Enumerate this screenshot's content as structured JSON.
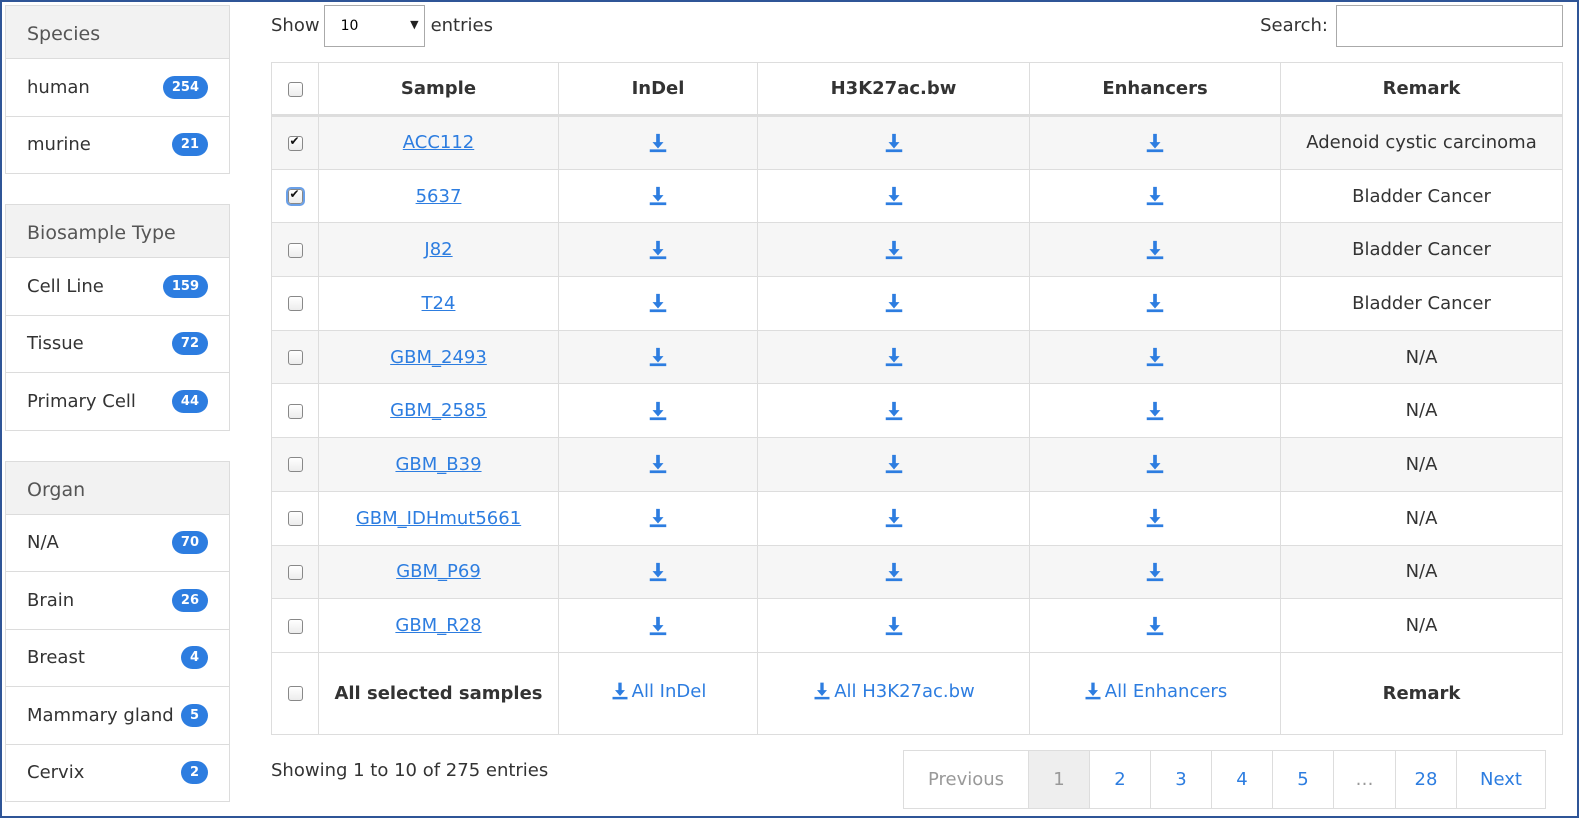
{
  "sidebar": {
    "species": {
      "title": "Species",
      "items": [
        {
          "label": "human",
          "count": "254"
        },
        {
          "label": "murine",
          "count": "21"
        }
      ]
    },
    "biosample": {
      "title": "Biosample Type",
      "items": [
        {
          "label": "Cell Line",
          "count": "159"
        },
        {
          "label": "Tissue",
          "count": "72"
        },
        {
          "label": "Primary Cell",
          "count": "44"
        }
      ]
    },
    "organ": {
      "title": "Organ",
      "items": [
        {
          "label": "N/A",
          "count": "70"
        },
        {
          "label": "Brain",
          "count": "26"
        },
        {
          "label": "Breast",
          "count": "4"
        },
        {
          "label": "Mammary gland",
          "count": "5"
        },
        {
          "label": "Cervix",
          "count": "2"
        }
      ]
    }
  },
  "controls": {
    "show_label": "Show",
    "entries_value": "10",
    "entries_label": "entries",
    "search_label": "Search:",
    "search_value": ""
  },
  "table": {
    "headers": {
      "sample": "Sample",
      "indel": "InDel",
      "h3k27ac": "H3K27ac.bw",
      "enhancers": "Enhancers",
      "remark": "Remark"
    },
    "rows": [
      {
        "sample": "ACC112",
        "remark": "Adenoid cystic carcinoma",
        "checked": true
      },
      {
        "sample": "5637",
        "remark": "Bladder Cancer",
        "checked": true
      },
      {
        "sample": "J82",
        "remark": "Bladder Cancer",
        "checked": false
      },
      {
        "sample": "T24",
        "remark": "Bladder Cancer",
        "checked": false
      },
      {
        "sample": "GBM_2493",
        "remark": "N/A",
        "checked": false
      },
      {
        "sample": "GBM_2585",
        "remark": "N/A",
        "checked": false
      },
      {
        "sample": "GBM_B39",
        "remark": "N/A",
        "checked": false
      },
      {
        "sample": "GBM_IDHmut5661",
        "remark": "N/A",
        "checked": false
      },
      {
        "sample": "GBM_P69",
        "remark": "N/A",
        "checked": false
      },
      {
        "sample": "GBM_R28",
        "remark": "N/A",
        "checked": false
      }
    ],
    "footer": {
      "label": "All selected samples",
      "all_indel": "All InDel",
      "all_h3k27ac": "All H3K27ac.bw",
      "all_enhancers": "All Enhancers",
      "remark": "Remark"
    }
  },
  "info": "Showing 1 to 10 of 275 entries",
  "pagination": {
    "previous": "Previous",
    "pages": [
      "1",
      "2",
      "3",
      "4",
      "5"
    ],
    "ellipsis": "…",
    "last": "28",
    "next": "Next"
  },
  "icons": {
    "download": "download-icon"
  },
  "colors": {
    "accent": "#2d7de0",
    "frame": "#2f5597"
  }
}
